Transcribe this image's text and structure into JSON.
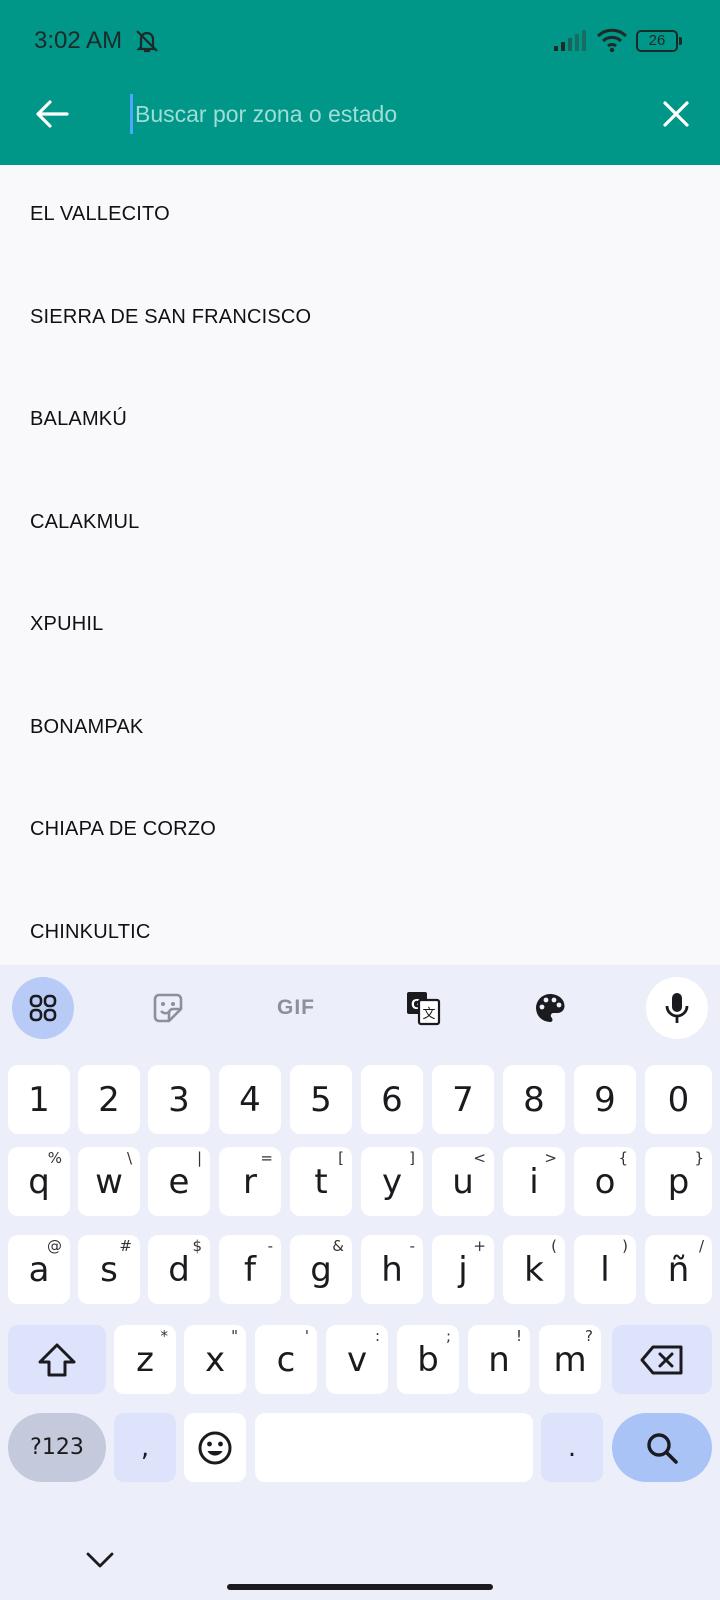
{
  "status_bar": {
    "time": "3:02 AM",
    "battery_level": "26",
    "icons": [
      "mute-icon",
      "signal-icon",
      "wifi-icon",
      "battery-icon"
    ]
  },
  "toolbar": {
    "search_placeholder": "Buscar por zona o estado",
    "search_value": "",
    "back_icon": "arrow-left-icon",
    "close_icon": "close-icon"
  },
  "results": [
    "EL VALLECITO",
    "SIERRA DE SAN FRANCISCO",
    "BALAMKÚ",
    "CALAKMUL",
    "XPUHIL",
    "BONAMPAK",
    "CHIAPA DE CORZO",
    "CHINKULTIC"
  ],
  "keyboard": {
    "toolbar": {
      "gif_label": "GIF",
      "icons": [
        "apps-grid-icon",
        "sticker-icon",
        "translate-icon",
        "palette-icon",
        "microphone-icon"
      ]
    },
    "number_row": [
      "1",
      "2",
      "3",
      "4",
      "5",
      "6",
      "7",
      "8",
      "9",
      "0"
    ],
    "row1": [
      {
        "k": "q",
        "h": "%"
      },
      {
        "k": "w",
        "h": "\\"
      },
      {
        "k": "e",
        "h": "|"
      },
      {
        "k": "r",
        "h": "="
      },
      {
        "k": "t",
        "h": "["
      },
      {
        "k": "y",
        "h": "]"
      },
      {
        "k": "u",
        "h": "<"
      },
      {
        "k": "i",
        "h": ">"
      },
      {
        "k": "o",
        "h": "{"
      },
      {
        "k": "p",
        "h": "}"
      }
    ],
    "row2": [
      {
        "k": "a",
        "h": "@"
      },
      {
        "k": "s",
        "h": "#"
      },
      {
        "k": "d",
        "h": "$"
      },
      {
        "k": "f",
        "h": "-"
      },
      {
        "k": "g",
        "h": "&"
      },
      {
        "k": "h",
        "h": "-"
      },
      {
        "k": "j",
        "h": "+"
      },
      {
        "k": "k",
        "h": "("
      },
      {
        "k": "l",
        "h": ")"
      },
      {
        "k": "ñ",
        "h": "/"
      }
    ],
    "row3": [
      {
        "k": "z",
        "h": "*"
      },
      {
        "k": "x",
        "h": "\""
      },
      {
        "k": "c",
        "h": "'"
      },
      {
        "k": "v",
        "h": ":"
      },
      {
        "k": "b",
        "h": ";"
      },
      {
        "k": "n",
        "h": "!"
      },
      {
        "k": "m",
        "h": "?"
      }
    ],
    "symbols_label": "?123",
    "comma_label": ",",
    "period_label": ".",
    "space_label": ""
  },
  "colors": {
    "header": "#009688",
    "accent_key": "#a9c3f7",
    "keyboard_bg": "#eceef9"
  }
}
